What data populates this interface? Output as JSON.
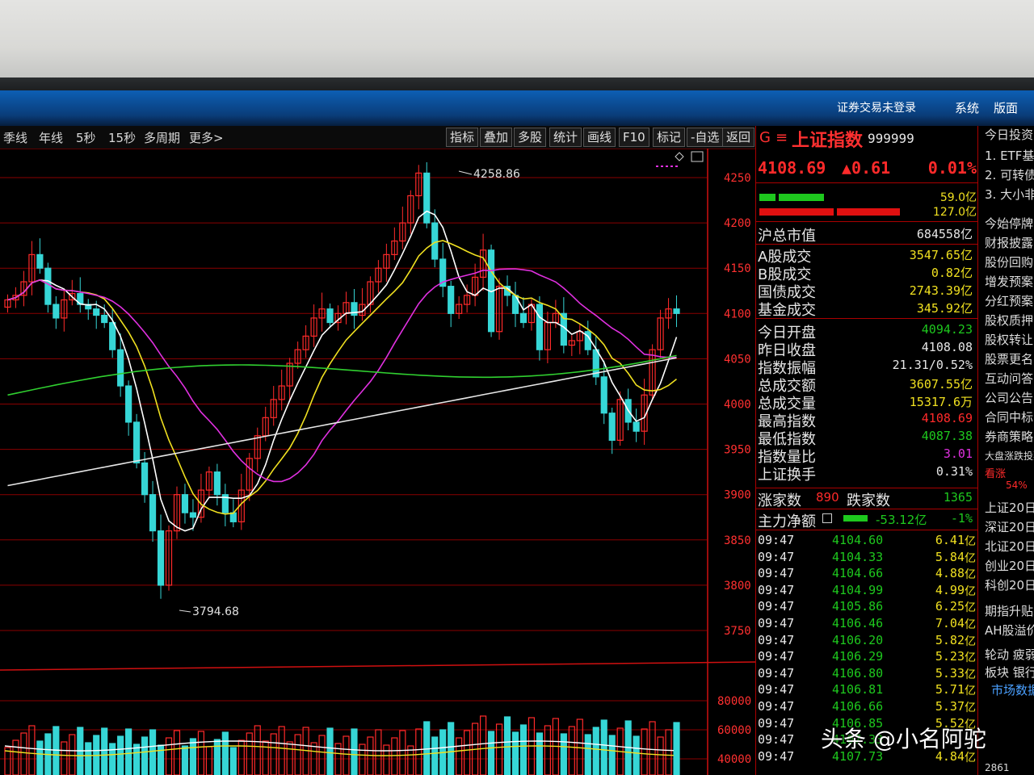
{
  "system": {
    "login_status": "证券交易未登录",
    "menu": [
      "系统",
      "版面"
    ]
  },
  "toolbar": {
    "periods": [
      "季线",
      "年线",
      "5秒",
      "15秒",
      "多周期",
      "更多>"
    ],
    "buttons": [
      "指标",
      "叠加",
      "多股",
      "统计",
      "画线",
      "F10",
      "标记",
      "-自选",
      "返回"
    ]
  },
  "chart": {
    "high_label": "4258.86",
    "low_label": "3794.68",
    "price_ticks": [
      "4250",
      "4200",
      "4150",
      "4100",
      "4050",
      "4000",
      "3950",
      "3900",
      "3850",
      "3800",
      "3750"
    ],
    "volume_ticks": [
      "80000",
      "60000",
      "40000"
    ],
    "colors": {
      "up": "#ff2a2a",
      "down": "#36d6d6",
      "ma5": "#ffffff",
      "ma10": "#f0e020",
      "ma20": "#e030e0",
      "ma60": "#30d030",
      "ma120": "#e8e8e8",
      "grid": "#8a0000"
    }
  },
  "quote": {
    "icon_g": "G",
    "icon_menu": "≡",
    "name": "上证指数",
    "code": "999999",
    "price": "4108.69",
    "change": "▲0.61",
    "change_pct": "0.01%",
    "bar_top_value": "59.0亿",
    "bar_bottom_value": "127.0亿",
    "market_cap_label": "沪总市值",
    "market_cap": "684558亿",
    "stats": [
      {
        "label": "A股成交",
        "value": "3547.65亿",
        "color": "#f0e020"
      },
      {
        "label": "B股成交",
        "value": "0.82亿",
        "color": "#f0e020"
      },
      {
        "label": "国债成交",
        "value": "2743.39亿",
        "color": "#f0e020"
      },
      {
        "label": "基金成交",
        "value": "345.92亿",
        "color": "#f0e020"
      },
      {
        "label": "今日开盘",
        "value": "4094.23",
        "color": "#1ec81e"
      },
      {
        "label": "昨日收盘",
        "value": "4108.08",
        "color": "#e6e6e6"
      },
      {
        "label": "指数振幅",
        "value": "21.31/0.52%",
        "color": "#e6e6e6"
      },
      {
        "label": "总成交额",
        "value": "3607.55亿",
        "color": "#f0e020"
      },
      {
        "label": "总成交量",
        "value": "15317.6万",
        "color": "#f0e020"
      },
      {
        "label": "最高指数",
        "value": "4108.69",
        "color": "#ff2a2a"
      },
      {
        "label": "最低指数",
        "value": "4087.38",
        "color": "#1ec81e"
      },
      {
        "label": "指数量比",
        "value": "3.01",
        "color": "#e030e0"
      },
      {
        "label": "上证换手",
        "value": "0.31%",
        "color": "#e6e6e6"
      }
    ],
    "up_label": "涨家数",
    "up_count": "890",
    "down_label": "跌家数",
    "down_count": "1365",
    "main_flow_label": "主力净额",
    "main_flow_value": "-53.12亿",
    "main_flow_pct": "-1%",
    "ticks": [
      {
        "time": "09:47",
        "price": "4104.60",
        "amount": "6.41",
        "unit": "亿"
      },
      {
        "time": "09:47",
        "price": "4104.33",
        "amount": "5.84",
        "unit": "亿"
      },
      {
        "time": "09:47",
        "price": "4104.66",
        "amount": "4.88",
        "unit": "亿"
      },
      {
        "time": "09:47",
        "price": "4104.99",
        "amount": "4.99",
        "unit": "亿"
      },
      {
        "time": "09:47",
        "price": "4105.86",
        "amount": "6.25",
        "unit": "亿"
      },
      {
        "time": "09:47",
        "price": "4106.46",
        "amount": "7.04",
        "unit": "亿"
      },
      {
        "time": "09:47",
        "price": "4106.20",
        "amount": "5.82",
        "unit": "亿"
      },
      {
        "time": "09:47",
        "price": "4106.29",
        "amount": "5.23",
        "unit": "亿"
      },
      {
        "time": "09:47",
        "price": "4106.80",
        "amount": "5.33",
        "unit": "亿"
      },
      {
        "time": "09:47",
        "price": "4106.81",
        "amount": "5.71",
        "unit": "亿"
      },
      {
        "time": "09:47",
        "price": "4106.66",
        "amount": "5.37",
        "unit": "亿"
      },
      {
        "time": "09:47",
        "price": "4106.85",
        "amount": "5.52",
        "unit": "亿"
      },
      {
        "time": "09:47",
        "price": "4107.33",
        "amount": "",
        "unit": ""
      },
      {
        "time": "09:47",
        "price": "4107.73",
        "amount": "4.84",
        "unit": "亿"
      }
    ]
  },
  "side": {
    "items": [
      "今日投资",
      "1. ETF基",
      "2. 可转债",
      "3. 大小非",
      "今始停牌",
      "财报披露",
      "股份回购",
      "增发预案",
      "分红预案",
      "股权质押",
      "股权转让",
      "股票更名",
      "互动问答",
      "公司公告",
      "合同中标",
      "券商策略",
      "大盘涨跌投票",
      "看涨",
      "54%",
      "上证20日",
      "深证20日",
      "北证20日",
      "创业20日",
      "科创20日",
      "期指升贴水",
      "AH股溢价",
      "轮动 疲弱市",
      "板块 银行 >",
      "市场数据",
      "2861"
    ]
  },
  "watermark": "头条 @小名阿驼"
}
